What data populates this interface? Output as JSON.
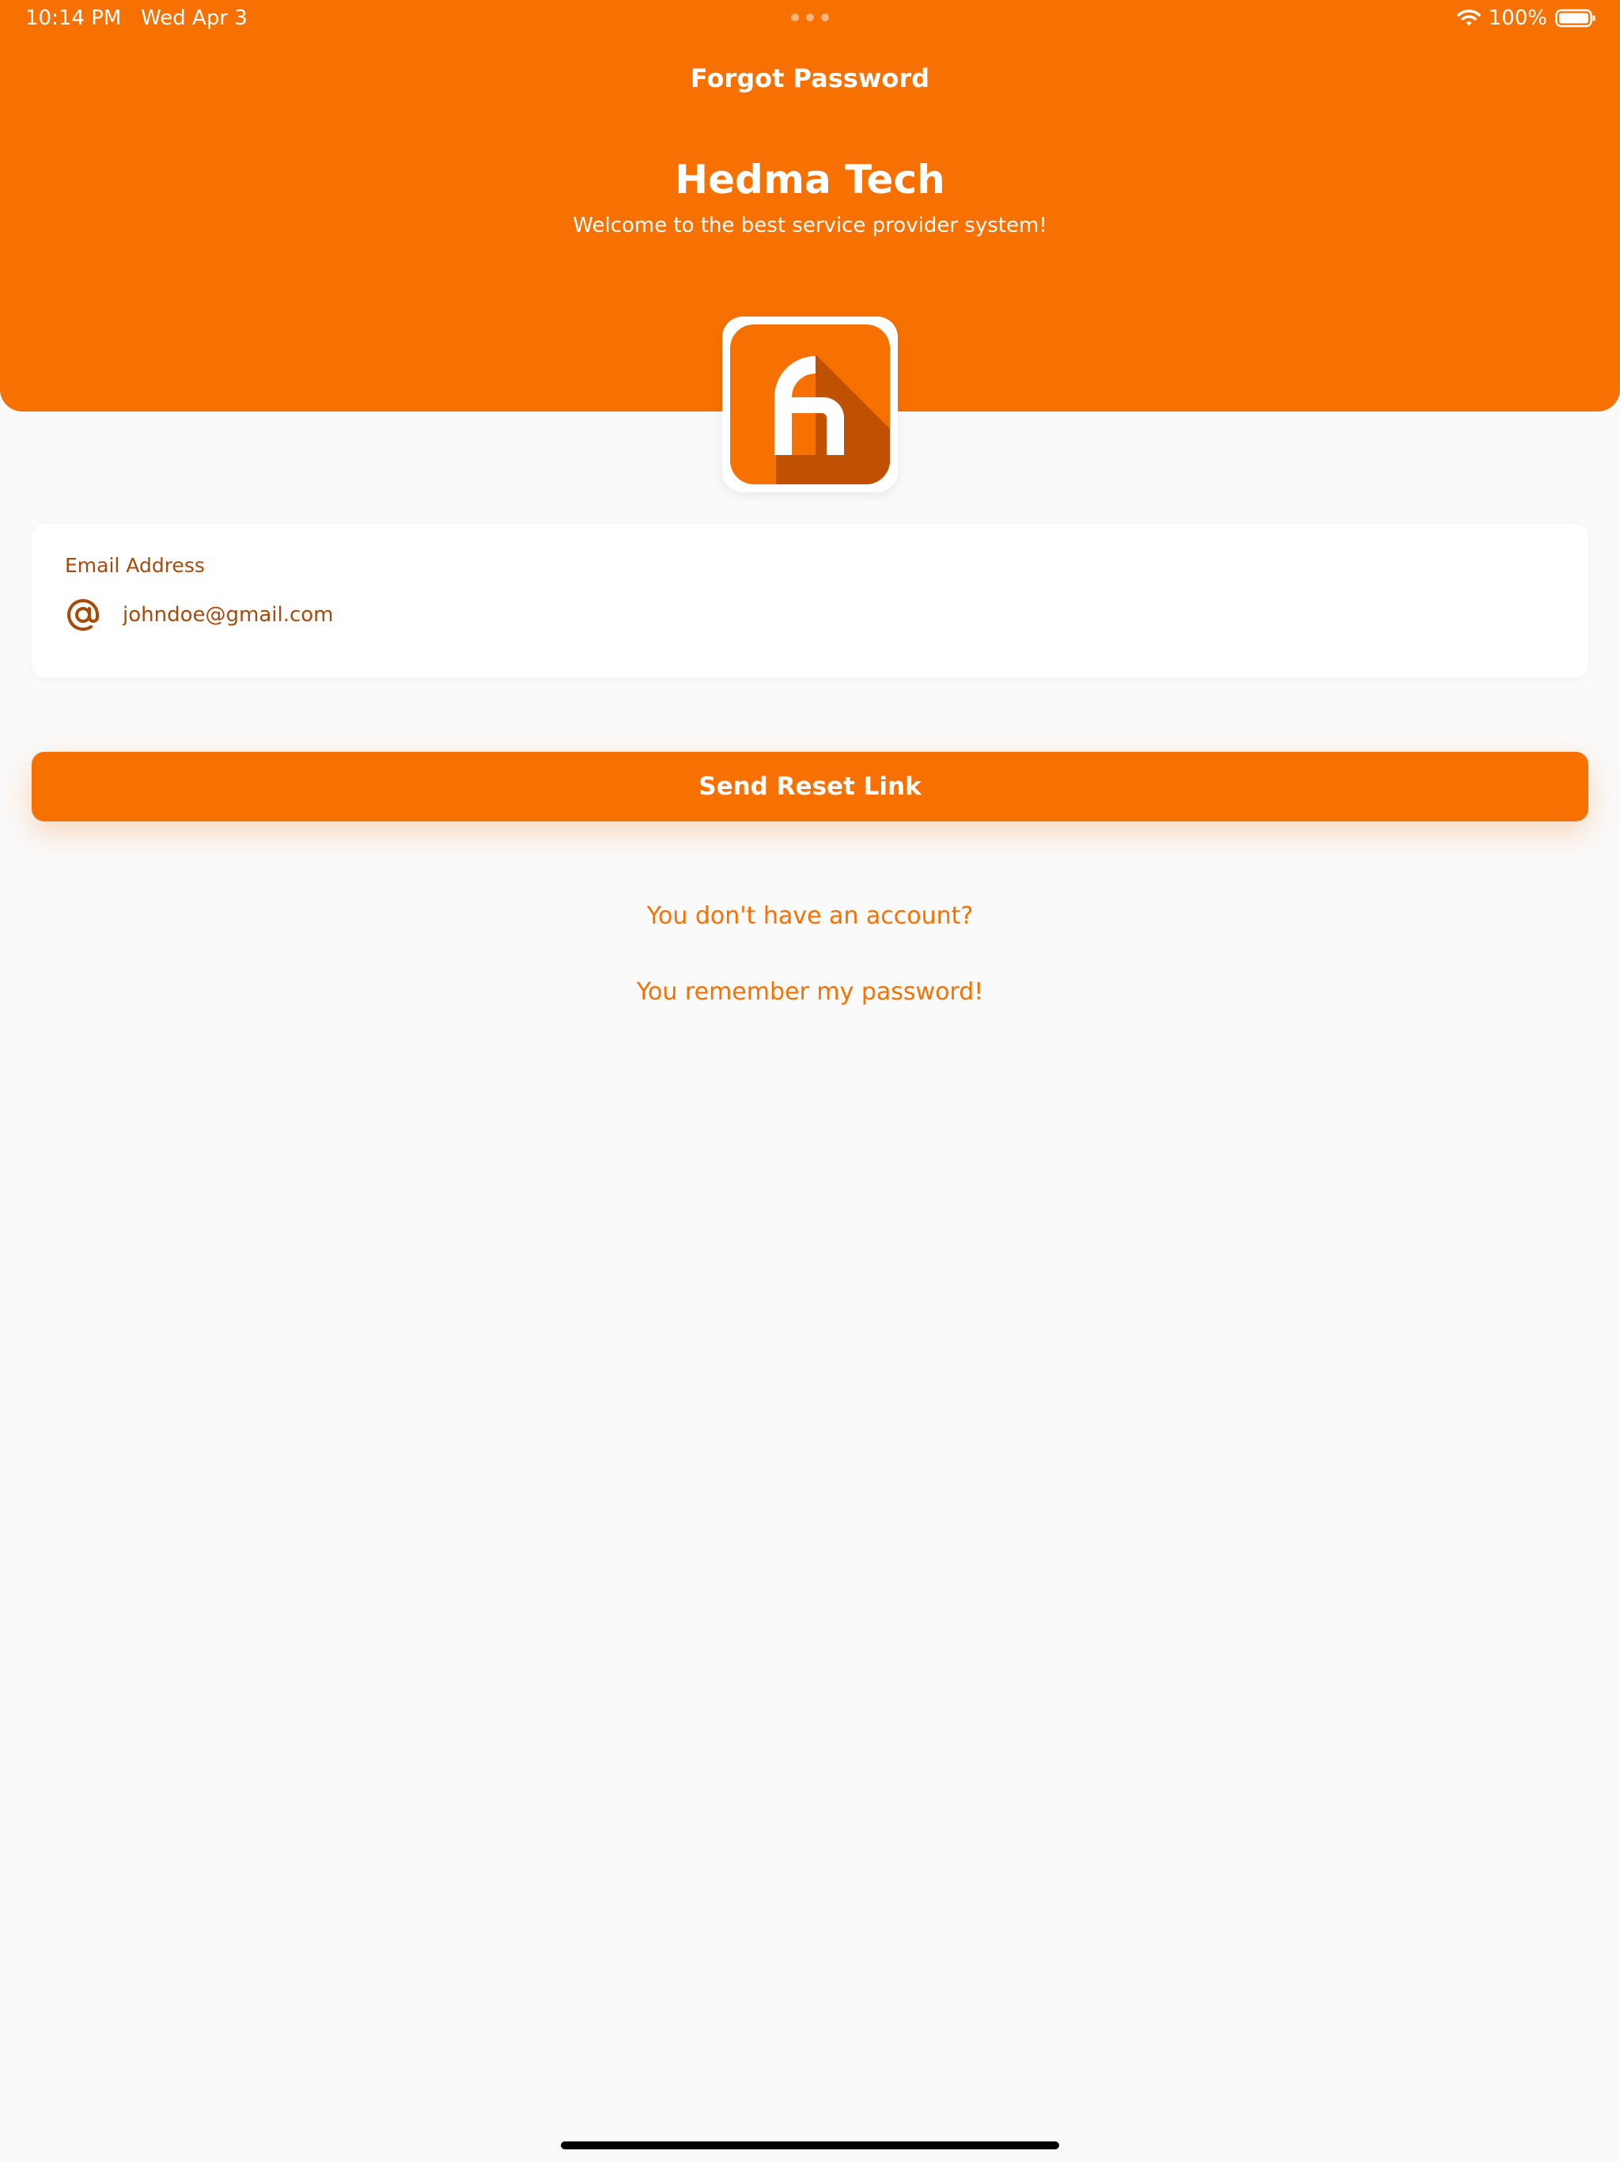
{
  "status_bar": {
    "time": "10:14 PM",
    "date": "Wed Apr 3",
    "battery": "100%",
    "wifi_icon": "wifi-icon",
    "battery_icon": "battery-icon"
  },
  "header": {
    "nav_title": "Forgot Password",
    "brand_title": "Hedma Tech",
    "brand_subtitle": "Welcome to the best service provider system!",
    "logo_icon": "hedma-logo-icon"
  },
  "form": {
    "email_label": "Email Address",
    "email_icon": "at-icon",
    "email_value": "johndoe@gmail.com",
    "submit_label": "Send Reset Link"
  },
  "links": {
    "signup": "You don't have an account?",
    "login": "You remember my password!"
  },
  "colors": {
    "primary": "#f77102",
    "primary_dark": "#c05002",
    "label_text": "#a84a0a",
    "background": "#fafafa"
  }
}
